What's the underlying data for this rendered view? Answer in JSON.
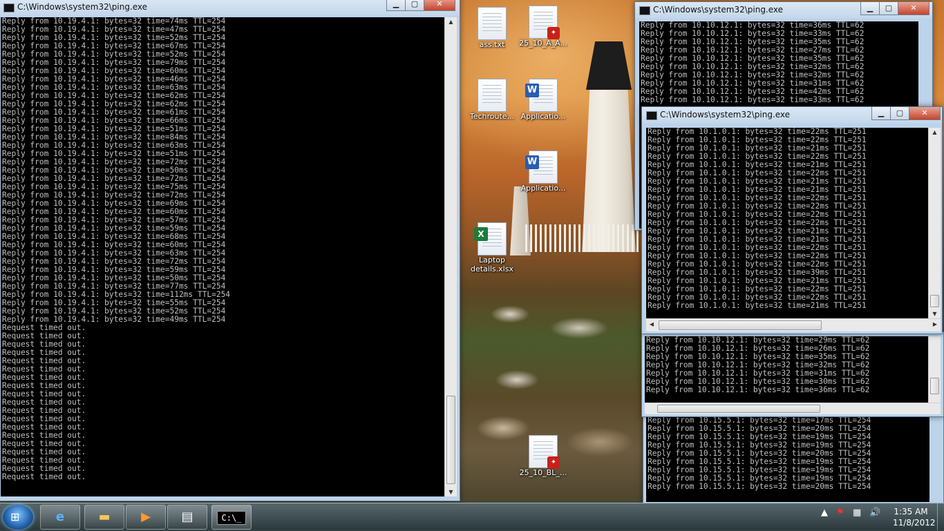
{
  "desktop": {
    "icons": [
      {
        "name": "ass-txt",
        "label": "ass.txt",
        "type": "text"
      },
      {
        "name": "pdf-25-10-a",
        "label": "25_10_A_A...",
        "type": "pdf"
      },
      {
        "name": "techroute-txt",
        "label": "Techroute...",
        "type": "text"
      },
      {
        "name": "word-application-1",
        "label": "Applicatio...",
        "type": "word"
      },
      {
        "name": "word-application-2",
        "label": "Applicatio...",
        "type": "word"
      },
      {
        "name": "laptop-details-xlsx",
        "label": "Laptop details.xlsx",
        "type": "excel"
      },
      {
        "name": "pdf-25-10-bl",
        "label": "25_10_BL_...",
        "type": "pdf"
      }
    ]
  },
  "windows": {
    "main": {
      "title": "C:\\Windows\\system32\\ping.exe",
      "lines": [
        "Reply from 10.19.4.1: bytes=32 time=74ms TTL=254",
        "Reply from 10.19.4.1: bytes=32 time=47ms TTL=254",
        "Reply from 10.19.4.1: bytes=32 time=52ms TTL=254",
        "Reply from 10.19.4.1: bytes=32 time=67ms TTL=254",
        "Reply from 10.19.4.1: bytes=32 time=52ms TTL=254",
        "Reply from 10.19.4.1: bytes=32 time=79ms TTL=254",
        "Reply from 10.19.4.1: bytes=32 time=60ms TTL=254",
        "Reply from 10.19.4.1: bytes=32 time=46ms TTL=254",
        "Reply from 10.19.4.1: bytes=32 time=63ms TTL=254",
        "Reply from 10.19.4.1: bytes=32 time=62ms TTL=254",
        "Reply from 10.19.4.1: bytes=32 time=62ms TTL=254",
        "Reply from 10.19.4.1: bytes=32 time=61ms TTL=254",
        "Reply from 10.19.4.1: bytes=32 time=66ms TTL=254",
        "Reply from 10.19.4.1: bytes=32 time=51ms TTL=254",
        "Reply from 10.19.4.1: bytes=32 time=84ms TTL=254",
        "Reply from 10.19.4.1: bytes=32 time=63ms TTL=254",
        "Reply from 10.19.4.1: bytes=32 time=51ms TTL=254",
        "Reply from 10.19.4.1: bytes=32 time=72ms TTL=254",
        "Reply from 10.19.4.1: bytes=32 time=50ms TTL=254",
        "Reply from 10.19.4.1: bytes=32 time=72ms TTL=254",
        "Reply from 10.19.4.1: bytes=32 time=75ms TTL=254",
        "Reply from 10.19.4.1: bytes=32 time=72ms TTL=254",
        "Reply from 10.19.4.1: bytes=32 time=69ms TTL=254",
        "Reply from 10.19.4.1: bytes=32 time=60ms TTL=254",
        "Reply from 10.19.4.1: bytes=32 time=57ms TTL=254",
        "Reply from 10.19.4.1: bytes=32 time=59ms TTL=254",
        "Reply from 10.19.4.1: bytes=32 time=68ms TTL=254",
        "Reply from 10.19.4.1: bytes=32 time=60ms TTL=254",
        "Reply from 10.19.4.1: bytes=32 time=63ms TTL=254",
        "Reply from 10.19.4.1: bytes=32 time=72ms TTL=254",
        "Reply from 10.19.4.1: bytes=32 time=59ms TTL=254",
        "Reply from 10.19.4.1: bytes=32 time=50ms TTL=254",
        "Reply from 10.19.4.1: bytes=32 time=77ms TTL=254",
        "Reply from 10.19.4.1: bytes=32 time=112ms TTL=254",
        "Reply from 10.19.4.1: bytes=32 time=55ms TTL=254",
        "Reply from 10.19.4.1: bytes=32 time=52ms TTL=254",
        "Reply from 10.19.4.1: bytes=32 time=49ms TTL=254",
        "Request timed out.",
        "Request timed out.",
        "Request timed out.",
        "Request timed out.",
        "Request timed out.",
        "Request timed out.",
        "Request timed out.",
        "Request timed out.",
        "Request timed out.",
        "Request timed out.",
        "Request timed out.",
        "Request timed out.",
        "Request timed out.",
        "Request timed out.",
        "Request timed out.",
        "Request timed out.",
        "Request timed out.",
        "Request timed out.",
        "Request timed out."
      ]
    },
    "top_right": {
      "title": "C:\\Windows\\system32\\ping.exe",
      "lines": [
        "Reply from 10.10.12.1: bytes=32 time=36ms TTL=62",
        "Reply from 10.10.12.1: bytes=32 time=33ms TTL=62",
        "Reply from 10.10.12.1: bytes=32 time=35ms TTL=62",
        "Reply from 10.10.12.1: bytes=32 time=27ms TTL=62",
        "Reply from 10.10.12.1: bytes=32 time=35ms TTL=62",
        "Reply from 10.10.12.1: bytes=32 time=32ms TTL=62",
        "Reply from 10.10.12.1: bytes=32 time=32ms TTL=62",
        "Reply from 10.10.12.1: bytes=32 time=31ms TTL=62",
        "Reply from 10.10.12.1: bytes=32 time=42ms TTL=62",
        "Reply from 10.10.12.1: bytes=32 time=33ms TTL=62"
      ]
    },
    "front": {
      "title": "C:\\Windows\\system32\\ping.exe",
      "lines": [
        "Reply from 10.1.0.1: bytes=32 time=22ms TTL=251",
        "Reply from 10.1.0.1: bytes=32 time=22ms TTL=251",
        "Reply from 10.1.0.1: bytes=32 time=21ms TTL=251",
        "Reply from 10.1.0.1: bytes=32 time=22ms TTL=251",
        "Reply from 10.1.0.1: bytes=32 time=21ms TTL=251",
        "Reply from 10.1.0.1: bytes=32 time=22ms TTL=251",
        "Reply from 10.1.0.1: bytes=32 time=21ms TTL=251",
        "Reply from 10.1.0.1: bytes=32 time=21ms TTL=251",
        "Reply from 10.1.0.1: bytes=32 time=22ms TTL=251",
        "Reply from 10.1.0.1: bytes=32 time=22ms TTL=251",
        "Reply from 10.1.0.1: bytes=32 time=22ms TTL=251",
        "Reply from 10.1.0.1: bytes=32 time=22ms TTL=251",
        "Reply from 10.1.0.1: bytes=32 time=21ms TTL=251",
        "Reply from 10.1.0.1: bytes=32 time=21ms TTL=251",
        "Reply from 10.1.0.1: bytes=32 time=22ms TTL=251",
        "Reply from 10.1.0.1: bytes=32 time=22ms TTL=251",
        "Reply from 10.1.0.1: bytes=32 time=22ms TTL=251",
        "Reply from 10.1.0.1: bytes=32 time=39ms TTL=251",
        "Reply from 10.1.0.1: bytes=32 time=21ms TTL=251",
        "Reply from 10.1.0.1: bytes=32 time=22ms TTL=251",
        "Reply from 10.1.0.1: bytes=32 time=22ms TTL=251",
        "Reply from 10.1.0.1: bytes=32 time=21ms TTL=251"
      ]
    },
    "middle_behind": {
      "lines": [
        "Reply from 10.10.12.1: bytes=32 time=29ms TTL=62",
        "Reply from 10.10.12.1: bytes=32 time=26ms TTL=62",
        "Reply from 10.10.12.1: bytes=32 time=35ms TTL=62",
        "Reply from 10.10.12.1: bytes=32 time=32ms TTL=62",
        "Reply from 10.10.12.1: bytes=32 time=31ms TTL=62",
        "Reply from 10.10.12.1: bytes=32 time=30ms TTL=62",
        "Reply from 10.10.12.1: bytes=32 time=36ms TTL=62"
      ]
    },
    "bottom_behind": {
      "lines": [
        "Reply from 10.15.5.1: bytes=32 time=17ms TTL=254",
        "Reply from 10.15.5.1: bytes=32 time=20ms TTL=254",
        "Reply from 10.15.5.1: bytes=32 time=19ms TTL=254",
        "Reply from 10.15.5.1: bytes=32 time=19ms TTL=254",
        "Reply from 10.15.5.1: bytes=32 time=20ms TTL=254",
        "Reply from 10.15.5.1: bytes=32 time=19ms TTL=254",
        "Reply from 10.15.5.1: bytes=32 time=19ms TTL=254",
        "Reply from 10.15.5.1: bytes=32 time=19ms TTL=254",
        "Reply from 10.15.5.1: bytes=32 time=20ms TTL=254"
      ]
    }
  },
  "taskbar": {
    "clock_time": "1:35 AM",
    "clock_date": "11/8/2012",
    "pinned": [
      "internet-explorer",
      "windows-explorer",
      "media-player",
      "document-viewer",
      "command-prompt"
    ]
  },
  "colors": {
    "console_bg": "#000000",
    "console_text": "#c0c0c0",
    "titlebar": "#c2d6ea",
    "close": "#c5442c"
  }
}
